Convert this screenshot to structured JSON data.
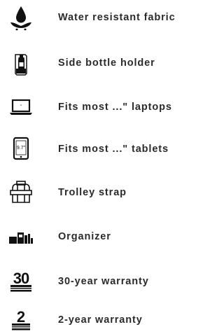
{
  "features": [
    {
      "label": "Water resistant fabric",
      "icon": "water-drop-icon"
    },
    {
      "label": "Side bottle holder",
      "icon": "bottle-holder-icon"
    },
    {
      "label": "Fits most ...\" laptops",
      "icon": "laptop-icon"
    },
    {
      "label": "Fits most ...\" tablets",
      "icon": "tablet-icon",
      "icon_text": "9.7\""
    },
    {
      "label": "Trolley strap",
      "icon": "trolley-strap-icon"
    },
    {
      "label": "Organizer",
      "icon": "organizer-icon"
    },
    {
      "label": "30-year warranty",
      "icon": "warranty-30-icon",
      "icon_text": "30"
    },
    {
      "label": "2-year warranty",
      "icon": "warranty-2-icon",
      "icon_text": "2"
    }
  ],
  "colors": {
    "icon": "#111111",
    "text": "#2b2b2b",
    "background": "#ffffff"
  }
}
